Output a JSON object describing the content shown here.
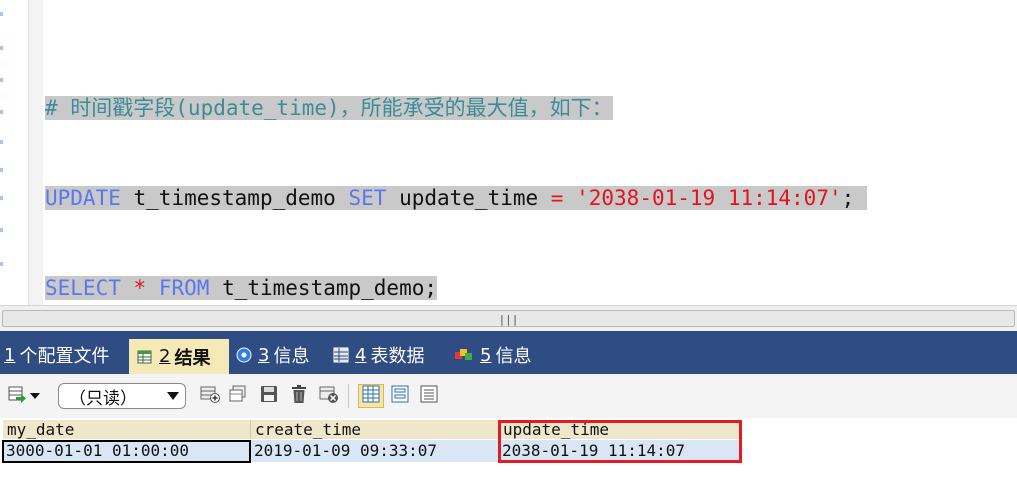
{
  "editor": {
    "line1": {
      "comment": "# 时间戳字段(update_time)，所能承受的最大值，如下："
    },
    "line2": {
      "kw1": "UPDATE",
      "table": "t_timestamp_demo",
      "kw2": "SET",
      "col": "update_time",
      "eq": "=",
      "value": "'2038-01-19 11:14:07'",
      "semi": ";"
    },
    "line3": {
      "kw1": "SELECT",
      "star": "*",
      "kw2": "FROM",
      "table": "t_timestamp_demo",
      "semi": ";"
    }
  },
  "tabs": [
    {
      "num": "1",
      "label": "个配置文件",
      "icon": "none"
    },
    {
      "num": "2",
      "label": "结果",
      "icon": "result-grid-icon"
    },
    {
      "num": "3",
      "label": "信息",
      "icon": "info-icon"
    },
    {
      "num": "4",
      "label": "表数据",
      "icon": "table-icon"
    },
    {
      "num": "5",
      "label": "信息",
      "icon": "colored-blocks-icon"
    }
  ],
  "toolbar": {
    "readonly_select": "（只读）"
  },
  "grid": {
    "columns": [
      "my_date",
      "create_time",
      "update_time"
    ],
    "rows": [
      [
        "3000-01-01 01:00:00",
        "2019-01-09 09:33:07",
        "2038-01-19 11:14:07"
      ]
    ]
  },
  "colors": {
    "tabbar": "#2f4c83",
    "active_tab": "#f6e9b8",
    "keyword": "#5a78ee",
    "string": "#e0141e",
    "comment": "#3c8c98",
    "highlight_red": "#e31b23"
  }
}
